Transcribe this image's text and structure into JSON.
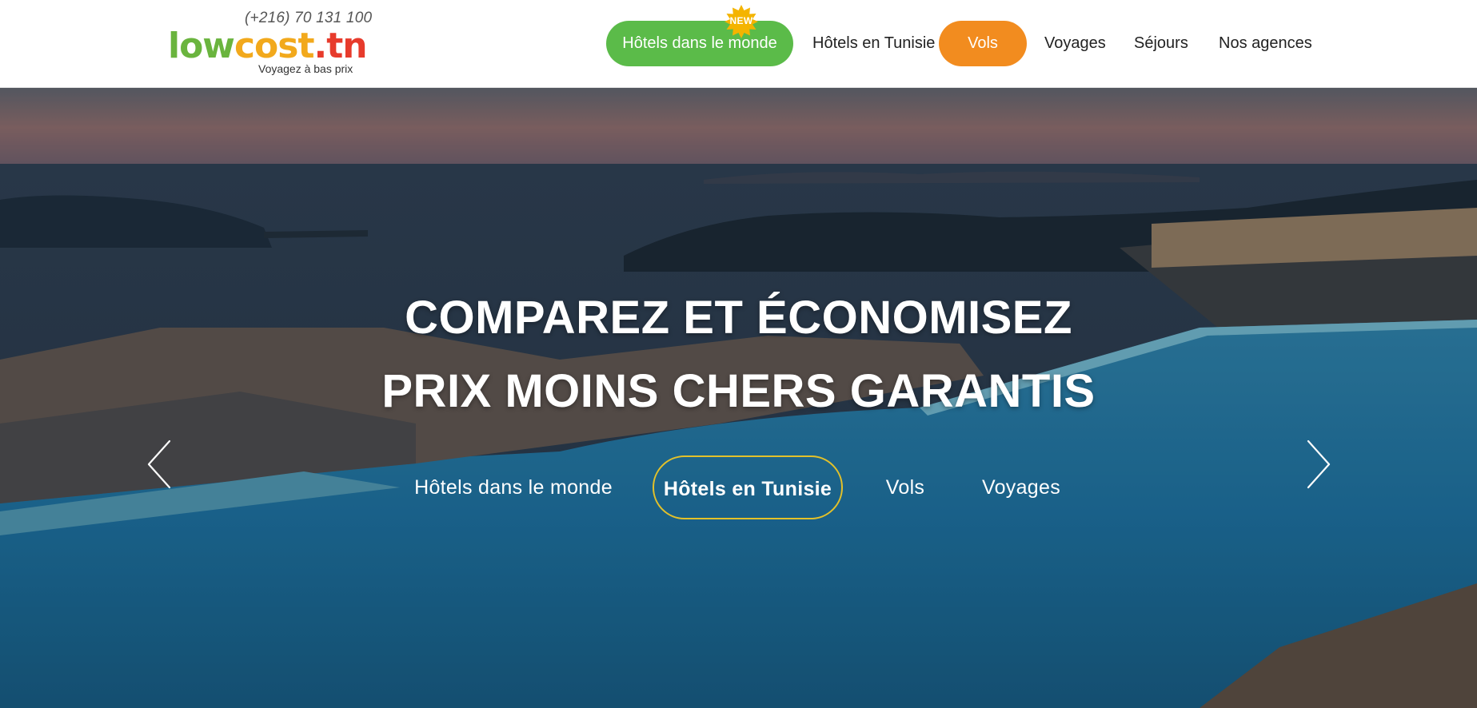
{
  "header": {
    "phone": "(+216) 70 131 100",
    "logo": {
      "part1": "low",
      "part2": "cost",
      "dot": ".",
      "part3": "tn"
    },
    "tagline": "Voyagez à bas prix",
    "colors": {
      "green": "#5bbb49",
      "orange": "#f28c1f",
      "red": "#e73b2c",
      "yellow": "#f2a91c"
    }
  },
  "nav": {
    "items": [
      {
        "label": "Hôtels dans le monde",
        "style": "green-pill",
        "badge": "NEW"
      },
      {
        "label": "Hôtels en Tunisie",
        "style": "plain"
      },
      {
        "label": "Vols",
        "style": "orange-pill"
      },
      {
        "label": "Voyages",
        "style": "plain"
      },
      {
        "label": "Séjours",
        "style": "plain"
      },
      {
        "label": "Nos agences",
        "style": "plain"
      }
    ]
  },
  "hero": {
    "headline1": "COMPAREZ ET ÉCONOMISEZ",
    "headline2": "PRIX MOINS CHERS GARANTIS",
    "tabs": [
      {
        "label": "Hôtels dans le monde",
        "active": false
      },
      {
        "label": "Hôtels en Tunisie",
        "active": true
      },
      {
        "label": "Vols",
        "active": false
      },
      {
        "label": "Voyages",
        "active": false
      }
    ],
    "prev_icon": "chevron-left-icon",
    "next_icon": "chevron-right-icon",
    "active_tab_border_color": "#e3c12a"
  }
}
